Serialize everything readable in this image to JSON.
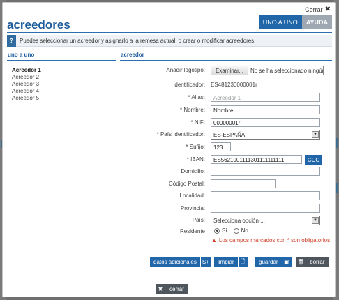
{
  "dialog": {
    "close_label": "Cerrar",
    "title": "acreedores",
    "mode_active": "UNO A UNO",
    "mode_help": "AYUDA",
    "info_text": "Puedes seleccionar un acreedor y asignarlo a la remesa actual, o crear o modificar acreedores."
  },
  "left_panel": {
    "heading": "uno a uno",
    "items": [
      "Acreedor 1",
      "Acreedor 2",
      "Acreedor 3",
      "Acreedor 4",
      "Acreedor 5"
    ]
  },
  "form": {
    "heading": "acreedor",
    "logo_label": "Añadir logotipo:",
    "logo_button": "Examinar...",
    "logo_file": "No se ha seleccionado ningún archivo.",
    "identificador_label": "Identificador:",
    "identificador_value": "ES481230000001r",
    "alias_label": "* Alias:",
    "alias_placeholder": "Acreedor 1",
    "nombre_label": "* Nombre:",
    "nombre_value": "Nombre",
    "nif_label": "* NIF:",
    "nif_value": "00000001r",
    "pais_id_label": "* País Identificador:",
    "pais_id_value": "ES-ESPAÑA",
    "sufijo_label": "* Sufijo:",
    "sufijo_value": "123",
    "iban_label": "* IBAN:",
    "iban_value": "ES5621001111301111111111",
    "ccc_button": "CCC",
    "domicilio_label": "Domicilio:",
    "cp_label": "Código Postal:",
    "localidad_label": "Localidad:",
    "provincia_label": "Provincia:",
    "pais_label": "País:",
    "pais_value": "Selecciona opción ...",
    "residente_label": "Residente",
    "residente_si": "Sí",
    "residente_no": "No",
    "warning": "Los campos marcados con * son obligatorios."
  },
  "actions": {
    "datos": "datos adicionales",
    "datos_icon": "S+",
    "limpiar": "limpiar",
    "guardar": "guardar",
    "borrar": "borrar",
    "cerrar": "cerrar"
  }
}
